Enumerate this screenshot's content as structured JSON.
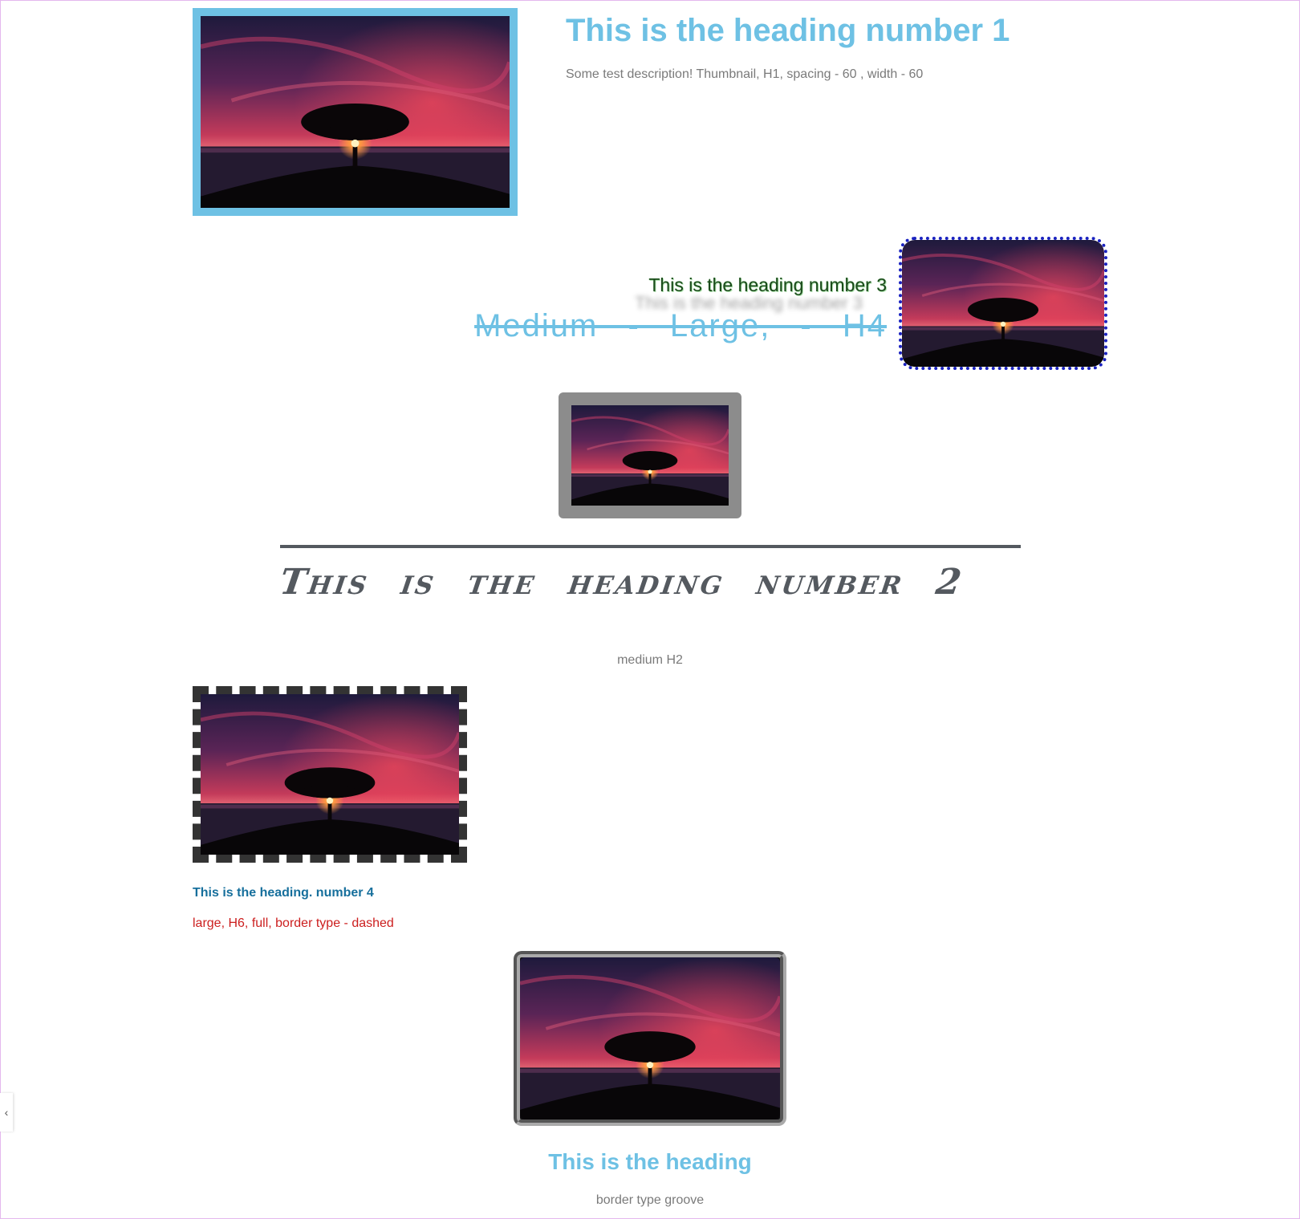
{
  "block1": {
    "title": "This is the heading number 1",
    "description": "Some test description! Thumbnail, H1, spacing - 60 , width - 60"
  },
  "block3": {
    "title": "This is the heading number 3",
    "description": "Medium - Large, - H4"
  },
  "block2": {
    "title": "This is the heading number 2",
    "description": "medium H2"
  },
  "block4": {
    "title": "This is the heading. number 4",
    "description": "large, H6, full, border type - dashed"
  },
  "block6": {
    "title": "This is the heading",
    "description": "border type groove"
  },
  "side_toggle": {
    "icon": "chevron-left-icon",
    "glyph": "‹"
  },
  "colors": {
    "accent": "#6ec1e4",
    "dotted_border": "#1a22c0",
    "heading4": "#166f9c",
    "desc4": "#cc1e1e",
    "dark": "#54595f"
  }
}
